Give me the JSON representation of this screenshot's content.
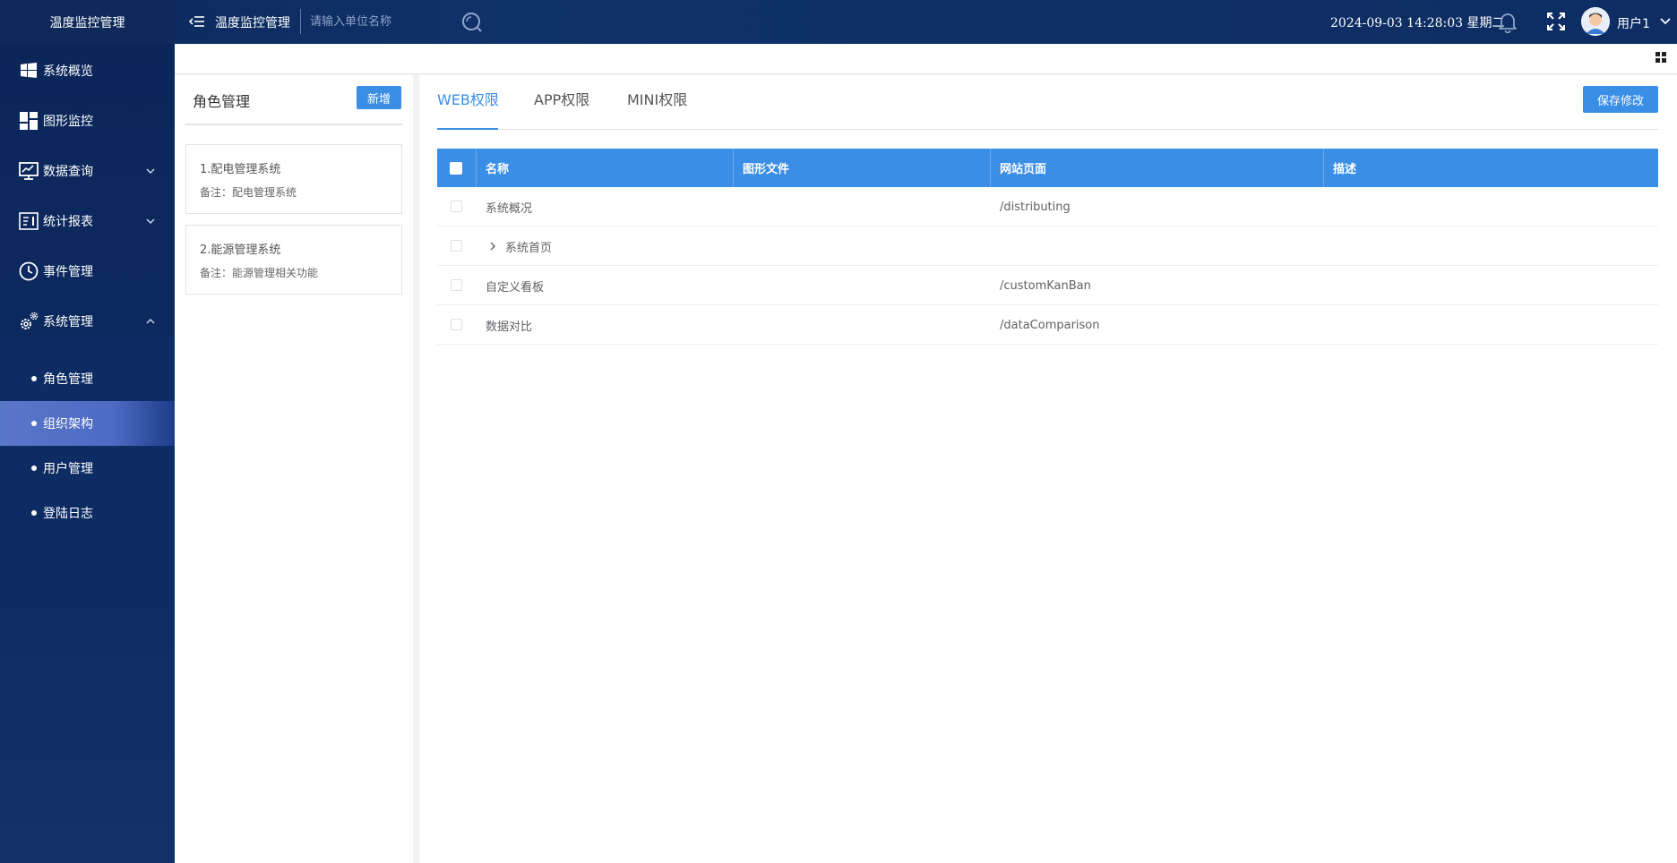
{
  "app": {
    "brand": "温度监控管理",
    "header_title": "温度监控管理",
    "search_placeholder": "请输入单位名称",
    "datetime": "2024-09-03 14:28:03 星期二",
    "username": "用户1"
  },
  "sidebar": {
    "items": [
      {
        "label": "系统概览",
        "icon": "windows-icon"
      },
      {
        "label": "图形监控",
        "icon": "dashboard-icon"
      },
      {
        "label": "数据查询",
        "icon": "monitor-icon",
        "arrow": "down"
      },
      {
        "label": "统计报表",
        "icon": "report-icon",
        "arrow": "down"
      },
      {
        "label": "事件管理",
        "icon": "clock-icon"
      },
      {
        "label": "系统管理",
        "icon": "gears-icon",
        "arrow": "up"
      }
    ],
    "subitems": [
      {
        "label": "角色管理"
      },
      {
        "label": "组织架构",
        "active": true
      },
      {
        "label": "用户管理"
      },
      {
        "label": "登陆日志"
      }
    ]
  },
  "role_panel": {
    "title": "角色管理",
    "add_label": "新增",
    "roles": [
      {
        "name": "1.配电管理系统",
        "note": "备注：配电管理系统"
      },
      {
        "name": "2.能源管理系统",
        "note": "备注：能源管理相关功能"
      }
    ]
  },
  "perm_panel": {
    "tabs": [
      "WEB权限",
      "APP权限",
      "MINI权限"
    ],
    "active_tab": 0,
    "save_label": "保存修改",
    "columns": [
      "名称",
      "图形文件",
      "网站页面",
      "描述"
    ],
    "rows": [
      {
        "name": "系统概况",
        "file": "",
        "page": "/distributing",
        "desc": ""
      },
      {
        "name": "系统首页",
        "file": "",
        "page": "",
        "desc": "",
        "expandable": true
      },
      {
        "name": "自定义看板",
        "file": "",
        "page": "/customKanBan",
        "desc": ""
      },
      {
        "name": "数据对比",
        "file": "",
        "page": "/dataComparison",
        "desc": ""
      }
    ]
  },
  "colors": {
    "accent": "#3a8ee6",
    "topbar": "#0f3169",
    "sidebar": "#0d2b62",
    "active_menu": "#5b76c9"
  }
}
